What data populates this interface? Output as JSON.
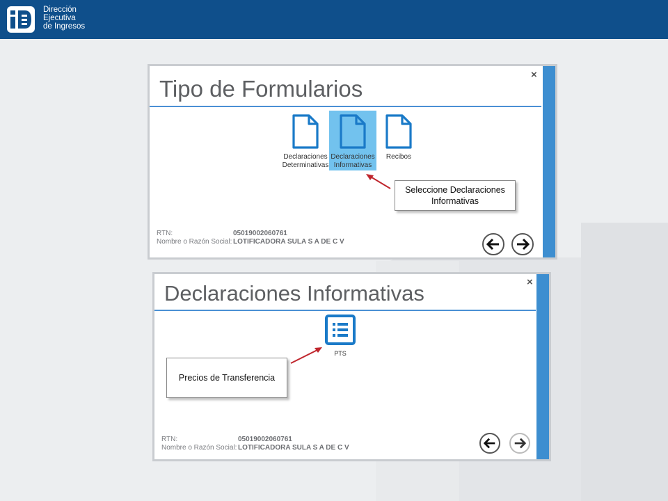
{
  "header": {
    "org_line1": "Dirección",
    "org_line2": "Ejecutiva",
    "org_line3": "de Ingresos",
    "bg_color": "#0f4f8b"
  },
  "panel_top": {
    "title": "Tipo de Formularios",
    "close_label": "×",
    "tiles": [
      {
        "line1": "Declaraciones",
        "line2": "Determinativas",
        "icon": "document-icon",
        "selected": false
      },
      {
        "line1": "Declaraciones",
        "line2": "Informativas",
        "icon": "document-icon",
        "selected": true
      },
      {
        "line1": "Recibos",
        "line2": "",
        "icon": "document-icon",
        "selected": false
      }
    ],
    "callout_line1": "Seleccione Declaraciones",
    "callout_line2": "Informativas",
    "rtn_label": "RTN:",
    "rtn_value": "05019002060761",
    "name_label": "Nombre o Razón Social:",
    "name_value": "LOTIFICADORA SULA S A DE C V"
  },
  "panel_bottom": {
    "title": "Declaraciones Informativas",
    "close_label": "×",
    "tile_label": "PTS",
    "tile_icon": "list-icon",
    "callout_text": "Precios de Transferencia",
    "rtn_label": "RTN:",
    "rtn_value": "05019002060761",
    "name_label": "Nombre o Razón Social:",
    "name_value": "LOTIFICADORA SULA S A DE C V"
  },
  "colors": {
    "accent": "#3d8ed0",
    "selected_tile": "#72c2ee",
    "arrow": "#c0262d"
  }
}
